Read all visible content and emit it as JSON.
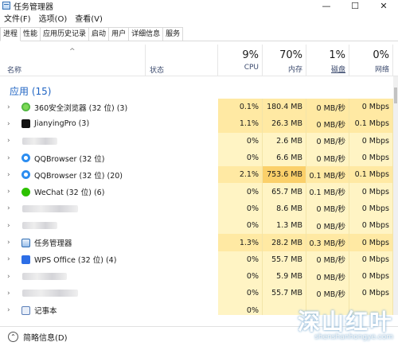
{
  "window": {
    "title": "任务管理器",
    "minimize": "—",
    "maximize": "☐",
    "close": "✕"
  },
  "menu": [
    "文件(F)",
    "选项(O)",
    "查看(V)"
  ],
  "tabs": [
    "进程",
    "性能",
    "应用历史记录",
    "启动",
    "用户",
    "详细信息",
    "服务"
  ],
  "header": {
    "sort_arrow": "^",
    "name": "名称",
    "status": "状态",
    "cpu": {
      "pct": "9%",
      "label": "CPU"
    },
    "mem": {
      "pct": "70%",
      "label": "内存"
    },
    "disk": {
      "pct": "1%",
      "label": "磁盘"
    },
    "net": {
      "pct": "0%",
      "label": "网络"
    }
  },
  "group": {
    "title": "应用 (15)"
  },
  "rows": [
    {
      "name": "360安全浏览器 (32 位) (3)",
      "icon": "360-browser-icon",
      "cpu": "0.1%",
      "mem": "180.4 MB",
      "disk": "0 MB/秒",
      "net": "0 Mbps",
      "shade": "shade2"
    },
    {
      "name": "JianyingPro (3)",
      "icon": "jianying-icon",
      "cpu": "1.1%",
      "mem": "26.3 MB",
      "disk": "0 MB/秒",
      "net": "0.1 Mbps",
      "shade": "shade2"
    },
    {
      "name": "",
      "icon": "blurred-icon",
      "cpu": "0%",
      "mem": "2.6 MB",
      "disk": "0 MB/秒",
      "net": "0 Mbps",
      "shade": "shade1",
      "blurred": true
    },
    {
      "name": "QQBrowser (32 位)",
      "icon": "qqbrowser-icon",
      "cpu": "0%",
      "mem": "6.6 MB",
      "disk": "0 MB/秒",
      "net": "0 Mbps",
      "shade": "shade1"
    },
    {
      "name": "QQBrowser (32 位) (20)",
      "icon": "qqbrowser-icon",
      "cpu": "2.1%",
      "mem": "753.6 MB",
      "disk": "0.1 MB/秒",
      "net": "0.1 Mbps",
      "shade": "shade2",
      "memShade": "shade4"
    },
    {
      "name": "WeChat (32 位) (6)",
      "icon": "wechat-icon",
      "cpu": "0%",
      "mem": "65.7 MB",
      "disk": "0.1 MB/秒",
      "net": "0 Mbps",
      "shade": "shade1"
    },
    {
      "name": "",
      "icon": "blurred-icon",
      "cpu": "0%",
      "mem": "8.6 MB",
      "disk": "0 MB/秒",
      "net": "0 Mbps",
      "shade": "shade1",
      "blurred": true
    },
    {
      "name": "",
      "icon": "blurred-icon",
      "cpu": "0%",
      "mem": "1.3 MB",
      "disk": "0 MB/秒",
      "net": "0 Mbps",
      "shade": "shade1",
      "blurred": true
    },
    {
      "name": "任务管理器",
      "icon": "task-manager-icon",
      "cpu": "1.3%",
      "mem": "28.2 MB",
      "disk": "0.3 MB/秒",
      "net": "0 Mbps",
      "shade": "shade2"
    },
    {
      "name": "WPS Office (32 位) (4)",
      "icon": "wps-icon",
      "cpu": "0%",
      "mem": "55.7 MB",
      "disk": "0 MB/秒",
      "net": "0 Mbps",
      "shade": "shade1"
    },
    {
      "name": "",
      "icon": "blurred-icon",
      "cpu": "0%",
      "mem": "5.9 MB",
      "disk": "0 MB/秒",
      "net": "0 Mbps",
      "shade": "shade1",
      "blurred": true
    },
    {
      "name": "",
      "icon": "blurred-icon",
      "cpu": "0%",
      "mem": "55.7 MB",
      "disk": "0 MB/秒",
      "net": "0 Mbps",
      "shade": "shade1",
      "blurred": true
    },
    {
      "name": "记事本",
      "icon": "notepad-icon",
      "cpu": "0%",
      "mem": "",
      "disk": "",
      "net": "",
      "shade": "shade1"
    }
  ],
  "footer": {
    "label": "简略信息(D)"
  },
  "watermark": {
    "big": "深山红叶",
    "small": "shenshanhongye.com"
  }
}
